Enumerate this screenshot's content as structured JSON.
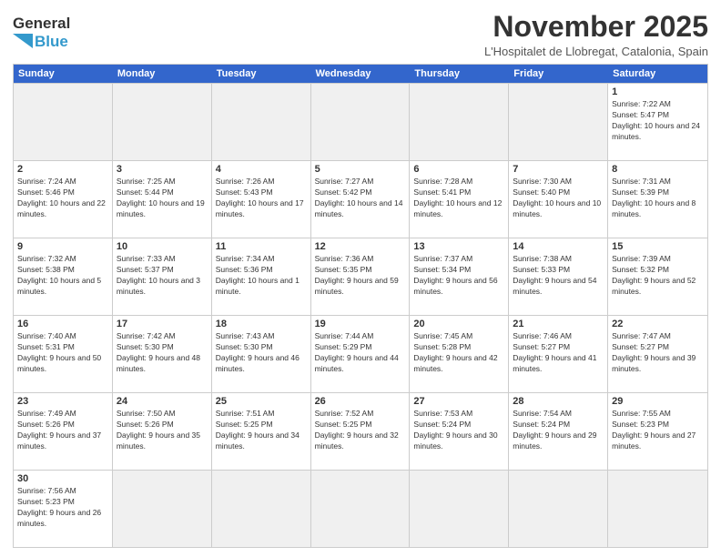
{
  "header": {
    "logo_general": "General",
    "logo_blue": "Blue",
    "month_title": "November 2025",
    "location": "L'Hospitalet de Llobregat, Catalonia, Spain"
  },
  "days_of_week": [
    "Sunday",
    "Monday",
    "Tuesday",
    "Wednesday",
    "Thursday",
    "Friday",
    "Saturday"
  ],
  "weeks": [
    [
      {
        "day": "",
        "empty": true
      },
      {
        "day": "",
        "empty": true
      },
      {
        "day": "",
        "empty": true
      },
      {
        "day": "",
        "empty": true
      },
      {
        "day": "",
        "empty": true
      },
      {
        "day": "",
        "empty": true
      },
      {
        "day": "1",
        "sunrise": "7:22 AM",
        "sunset": "5:47 PM",
        "daylight": "10 hours and 24 minutes."
      }
    ],
    [
      {
        "day": "2",
        "sunrise": "7:24 AM",
        "sunset": "5:46 PM",
        "daylight": "10 hours and 22 minutes."
      },
      {
        "day": "3",
        "sunrise": "7:25 AM",
        "sunset": "5:44 PM",
        "daylight": "10 hours and 19 minutes."
      },
      {
        "day": "4",
        "sunrise": "7:26 AM",
        "sunset": "5:43 PM",
        "daylight": "10 hours and 17 minutes."
      },
      {
        "day": "5",
        "sunrise": "7:27 AM",
        "sunset": "5:42 PM",
        "daylight": "10 hours and 14 minutes."
      },
      {
        "day": "6",
        "sunrise": "7:28 AM",
        "sunset": "5:41 PM",
        "daylight": "10 hours and 12 minutes."
      },
      {
        "day": "7",
        "sunrise": "7:30 AM",
        "sunset": "5:40 PM",
        "daylight": "10 hours and 10 minutes."
      },
      {
        "day": "8",
        "sunrise": "7:31 AM",
        "sunset": "5:39 PM",
        "daylight": "10 hours and 8 minutes."
      }
    ],
    [
      {
        "day": "9",
        "sunrise": "7:32 AM",
        "sunset": "5:38 PM",
        "daylight": "10 hours and 5 minutes."
      },
      {
        "day": "10",
        "sunrise": "7:33 AM",
        "sunset": "5:37 PM",
        "daylight": "10 hours and 3 minutes."
      },
      {
        "day": "11",
        "sunrise": "7:34 AM",
        "sunset": "5:36 PM",
        "daylight": "10 hours and 1 minute."
      },
      {
        "day": "12",
        "sunrise": "7:36 AM",
        "sunset": "5:35 PM",
        "daylight": "9 hours and 59 minutes."
      },
      {
        "day": "13",
        "sunrise": "7:37 AM",
        "sunset": "5:34 PM",
        "daylight": "9 hours and 56 minutes."
      },
      {
        "day": "14",
        "sunrise": "7:38 AM",
        "sunset": "5:33 PM",
        "daylight": "9 hours and 54 minutes."
      },
      {
        "day": "15",
        "sunrise": "7:39 AM",
        "sunset": "5:32 PM",
        "daylight": "9 hours and 52 minutes."
      }
    ],
    [
      {
        "day": "16",
        "sunrise": "7:40 AM",
        "sunset": "5:31 PM",
        "daylight": "9 hours and 50 minutes."
      },
      {
        "day": "17",
        "sunrise": "7:42 AM",
        "sunset": "5:30 PM",
        "daylight": "9 hours and 48 minutes."
      },
      {
        "day": "18",
        "sunrise": "7:43 AM",
        "sunset": "5:30 PM",
        "daylight": "9 hours and 46 minutes."
      },
      {
        "day": "19",
        "sunrise": "7:44 AM",
        "sunset": "5:29 PM",
        "daylight": "9 hours and 44 minutes."
      },
      {
        "day": "20",
        "sunrise": "7:45 AM",
        "sunset": "5:28 PM",
        "daylight": "9 hours and 42 minutes."
      },
      {
        "day": "21",
        "sunrise": "7:46 AM",
        "sunset": "5:27 PM",
        "daylight": "9 hours and 41 minutes."
      },
      {
        "day": "22",
        "sunrise": "7:47 AM",
        "sunset": "5:27 PM",
        "daylight": "9 hours and 39 minutes."
      }
    ],
    [
      {
        "day": "23",
        "sunrise": "7:49 AM",
        "sunset": "5:26 PM",
        "daylight": "9 hours and 37 minutes."
      },
      {
        "day": "24",
        "sunrise": "7:50 AM",
        "sunset": "5:26 PM",
        "daylight": "9 hours and 35 minutes."
      },
      {
        "day": "25",
        "sunrise": "7:51 AM",
        "sunset": "5:25 PM",
        "daylight": "9 hours and 34 minutes."
      },
      {
        "day": "26",
        "sunrise": "7:52 AM",
        "sunset": "5:25 PM",
        "daylight": "9 hours and 32 minutes."
      },
      {
        "day": "27",
        "sunrise": "7:53 AM",
        "sunset": "5:24 PM",
        "daylight": "9 hours and 30 minutes."
      },
      {
        "day": "28",
        "sunrise": "7:54 AM",
        "sunset": "5:24 PM",
        "daylight": "9 hours and 29 minutes."
      },
      {
        "day": "29",
        "sunrise": "7:55 AM",
        "sunset": "5:23 PM",
        "daylight": "9 hours and 27 minutes."
      }
    ],
    [
      {
        "day": "30",
        "sunrise": "7:56 AM",
        "sunset": "5:23 PM",
        "daylight": "9 hours and 26 minutes."
      },
      {
        "day": "",
        "empty": true
      },
      {
        "day": "",
        "empty": true
      },
      {
        "day": "",
        "empty": true
      },
      {
        "day": "",
        "empty": true
      },
      {
        "day": "",
        "empty": true
      },
      {
        "day": "",
        "empty": true
      }
    ]
  ]
}
